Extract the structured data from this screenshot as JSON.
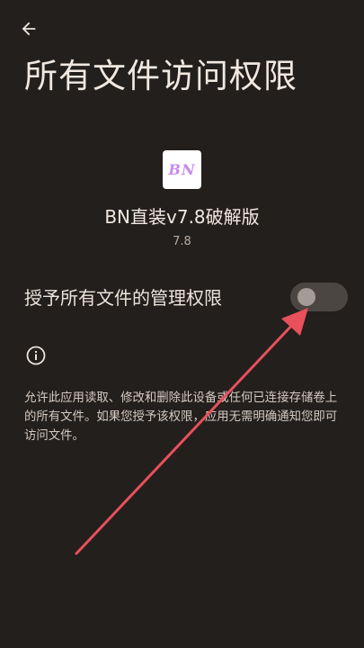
{
  "header": {
    "title": "所有文件访问权限"
  },
  "app": {
    "icon_text": "BN",
    "name": "BN直装v7.8破解版",
    "version": "7.8"
  },
  "permission": {
    "label": "授予所有文件的管理权限",
    "enabled": false
  },
  "info": {
    "description": "允许此应用读取、修改和删除此设备或任何已连接存储卷上的所有文件。如果您授予该权限，应用无需明确通知您即可访问文件。"
  },
  "colors": {
    "background": "#231f1c",
    "annotation_arrow": "#e8505b"
  }
}
